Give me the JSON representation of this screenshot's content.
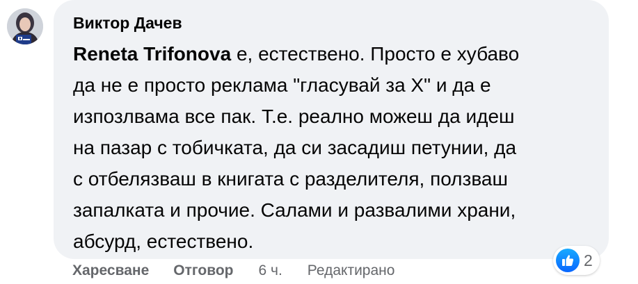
{
  "comment": {
    "author": "Виктор Дачев",
    "mention": "Reneta Trifonova",
    "lines": [
      " е, естествено. Просто е хубаво",
      "да не е просто реклама \"гласувай за Х\" и да е",
      "изпозлвама все пак. Т.е. реално можеш да идеш",
      "на пазар с тобичката, да си засадиш петунии, да",
      "с отбелязваш в книгата с разделителя, ползваш",
      "запалката и прочие. Салами и развалими храни,",
      "абсурд, естествено."
    ]
  },
  "reactions": {
    "icon": "like-icon",
    "count": "2",
    "color": "#0866ff"
  },
  "actions": {
    "like_label": "Харесване",
    "reply_label": "Отговор",
    "time": "6 ч.",
    "edited": "Редактирано"
  }
}
